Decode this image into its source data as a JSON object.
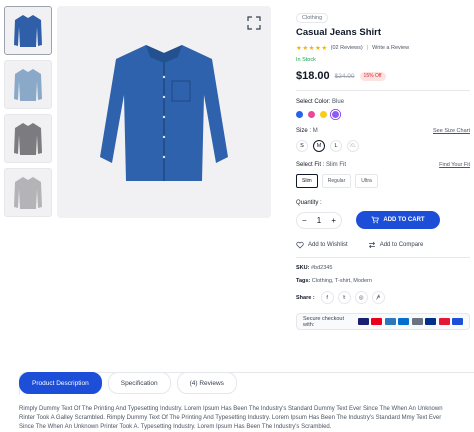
{
  "gallery": {
    "thumbnails": [
      {
        "name": "thumb-blue",
        "color": "#2f5fa8"
      },
      {
        "name": "thumb-light-blue",
        "color": "#8aa8c8"
      },
      {
        "name": "thumb-gray",
        "color": "#7c7c80"
      },
      {
        "name": "thumb-light-gray",
        "color": "#b4b4b8"
      }
    ]
  },
  "product": {
    "category": "Clothing",
    "title": "Casual Jeans Shirt",
    "reviews": "(02 Reviews)",
    "write_review": "Write a Review",
    "stock": "In Stock",
    "price": "$18.00",
    "old_price": "$24.00",
    "discount": "15% Off",
    "color_label": "Select Color:",
    "color_value": "Blue",
    "colors": [
      "#2563eb",
      "#ec4899",
      "#facc15",
      "#8b5cf6"
    ],
    "size_label": "Size :",
    "size_value": "M",
    "size_chart": "See Size Chart",
    "sizes": [
      "S",
      "M",
      "L",
      "XL"
    ],
    "fit_label": "Select Fit :",
    "fit_value": "Slim Fit",
    "find_fit": "Find Your Fit",
    "fits": [
      "Slim",
      "Regular",
      "Ultra"
    ],
    "quantity_label": "Quantity :",
    "quantity": "1",
    "add_to_cart": "ADD TO CART",
    "wishlist": "Add to Wishlist",
    "compare": "Add to Compare",
    "sku_label": "SKU:",
    "sku": "#bd2345",
    "tags_label": "Tags:",
    "tags": "Clothing, T-shirt, Modern",
    "share_label": "Share :",
    "social_icons": [
      "f",
      "t",
      "ig",
      "p"
    ],
    "checkout_label": "Secure checkout with:",
    "payments": [
      "#1a1f71",
      "#eb001b",
      "#2e77bc",
      "#016fd0",
      "#6b7280",
      "#003087",
      "#e21836",
      "#1d4ed8"
    ]
  },
  "tabs": [
    "Product Description",
    "Specification",
    "(4) Reviews"
  ],
  "description": {
    "line1": "Rimply Dummy Text Of The Printing And Typesetting Industry. Lorem Ipsum Has Been The Industry's Standard Dummy Text Ever Since The When An Unknown",
    "line2": "Rinter Took A Galley Scrambled. Rimply Dummy Text Of The Printing And Typesetting Industry. Lorem Ipsum Has Been The Industry's Standard Mmy Text Ever",
    "line3": "Since The When An Unknown Printer Took A. Typesetting Industry. Lorem Ipsum Has Been The Industry's Scrambled."
  }
}
